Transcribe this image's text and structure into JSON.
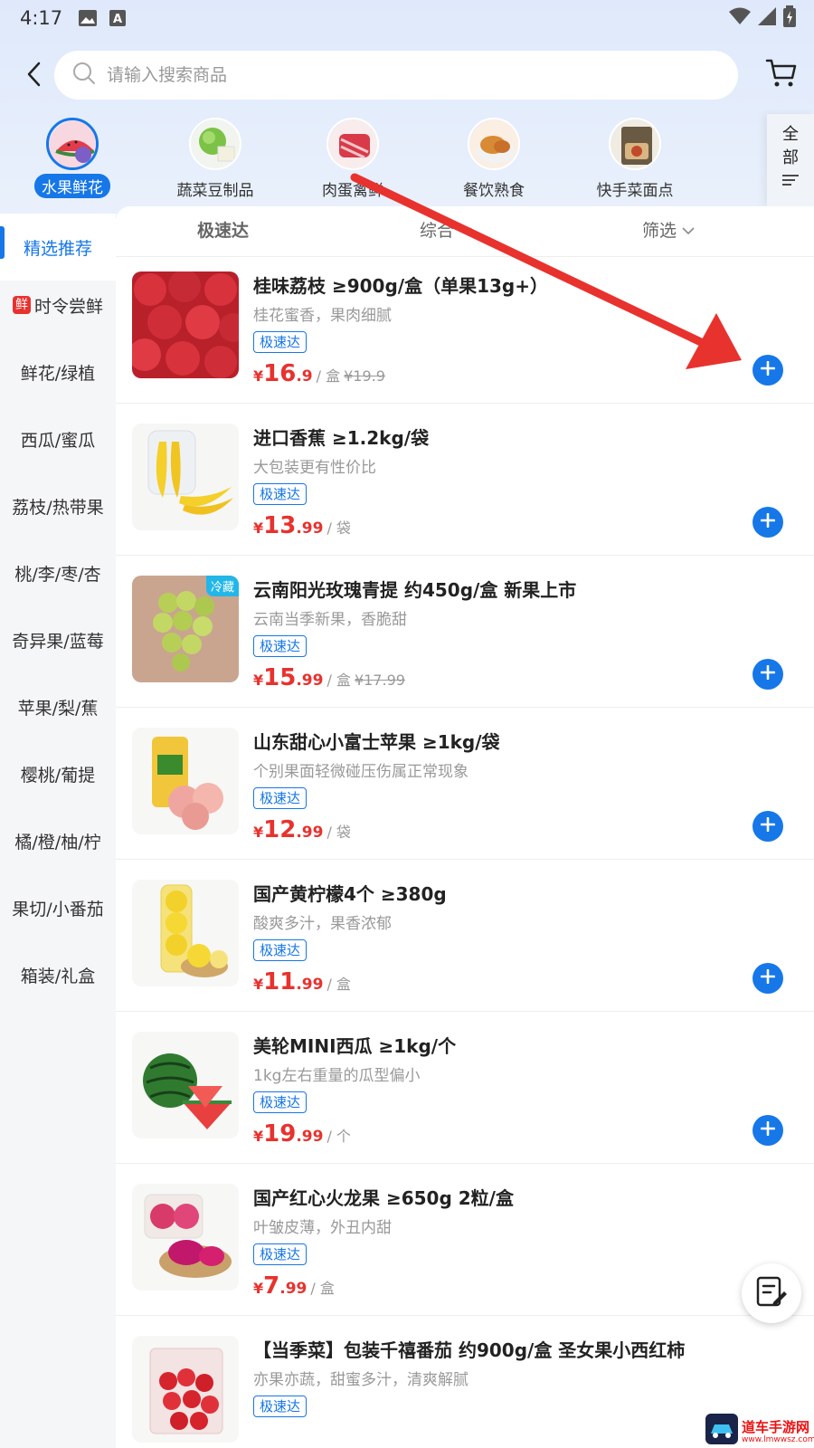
{
  "status_bar": {
    "time": "4:17"
  },
  "search": {
    "placeholder": "请输入搜索商品"
  },
  "categories": [
    {
      "label": "水果鲜花",
      "icon": "fruit-flowers"
    },
    {
      "label": "蔬菜豆制品",
      "icon": "vegetables-tofu"
    },
    {
      "label": "肉蛋禽鲜",
      "icon": "meat-eggs"
    },
    {
      "label": "餐饮熟食",
      "icon": "cooked-food"
    },
    {
      "label": "快手菜面点",
      "icon": "quick-dishes"
    }
  ],
  "all_categories": {
    "label_top": "全",
    "label_bottom": "部"
  },
  "sidebar": {
    "items": [
      {
        "label": "精选推荐"
      },
      {
        "label": "时令尝鲜",
        "tag": "鲜"
      },
      {
        "label": "鲜花/绿植"
      },
      {
        "label": "西瓜/蜜瓜"
      },
      {
        "label": "荔枝/热带果"
      },
      {
        "label": "桃/李/枣/杏"
      },
      {
        "label": "奇异果/蓝莓"
      },
      {
        "label": "苹果/梨/蕉"
      },
      {
        "label": "樱桃/葡提"
      },
      {
        "label": "橘/橙/柚/柠"
      },
      {
        "label": "果切/小番茄"
      },
      {
        "label": "箱装/礼盒"
      }
    ]
  },
  "filters": {
    "express": "极速达",
    "sort": "综合",
    "filter": "筛选"
  },
  "products": [
    {
      "name": "桂味荔枝 ≥900g/盒（单果13g+）",
      "desc": "桂花蜜香，果肉细腻",
      "tag": "极速达",
      "yen": "¥",
      "price_int": "16",
      "price_dec": ".9",
      "unit": "/ 盒",
      "orig": "¥19.9",
      "image": "lychee",
      "cold": ""
    },
    {
      "name": "进口香蕉 ≥1.2kg/袋",
      "desc": "大包装更有性价比",
      "tag": "极速达",
      "yen": "¥",
      "price_int": "13",
      "price_dec": ".99",
      "unit": "/ 袋",
      "orig": "",
      "image": "banana",
      "cold": ""
    },
    {
      "name": "云南阳光玫瑰青提 约450g/盒 新果上市",
      "desc": "云南当季新果，香脆甜",
      "tag": "极速达",
      "yen": "¥",
      "price_int": "15",
      "price_dec": ".99",
      "unit": "/ 盒",
      "orig": "¥17.99",
      "image": "green-grapes",
      "cold": "冷藏"
    },
    {
      "name": "山东甜心小富士苹果 ≥1kg/袋",
      "desc": "个别果面轻微碰压伤属正常现象",
      "tag": "极速达",
      "yen": "¥",
      "price_int": "12",
      "price_dec": ".99",
      "unit": "/ 袋",
      "orig": "",
      "image": "apples",
      "cold": ""
    },
    {
      "name": "国产黄柠檬4个 ≥380g",
      "desc": "酸爽多汁，果香浓郁",
      "tag": "极速达",
      "yen": "¥",
      "price_int": "11",
      "price_dec": ".99",
      "unit": "/ 盒",
      "orig": "",
      "image": "lemons",
      "cold": ""
    },
    {
      "name": "美轮MINI西瓜 ≥1kg/个",
      "desc": "1kg左右重量的瓜型偏小",
      "tag": "极速达",
      "yen": "¥",
      "price_int": "19",
      "price_dec": ".99",
      "unit": "/ 个",
      "orig": "",
      "image": "mini-watermelon",
      "cold": ""
    },
    {
      "name": "国产红心火龙果 ≥650g 2粒/盒",
      "desc": "叶皱皮薄，外丑内甜",
      "tag": "极速达",
      "yen": "¥",
      "price_int": "7",
      "price_dec": ".99",
      "unit": "/ 盒",
      "orig": "",
      "image": "dragon-fruit",
      "cold": ""
    },
    {
      "name": "【当季菜】包装千禧番茄 约900g/盒 圣女果小西红柿",
      "desc": "亦果亦蔬，甜蜜多汁，清爽解腻",
      "tag": "极速达",
      "yen": "",
      "price_int": "",
      "price_dec": "",
      "unit": "",
      "orig": "",
      "image": "cherry-tomatoes",
      "cold": ""
    }
  ],
  "watermark": {
    "name": "道车手游网",
    "url": "www.lmwwsz.com"
  },
  "colors": {
    "accent": "#1677e8",
    "price": "#e8322e",
    "annotation_arrow": "#e8322e"
  }
}
